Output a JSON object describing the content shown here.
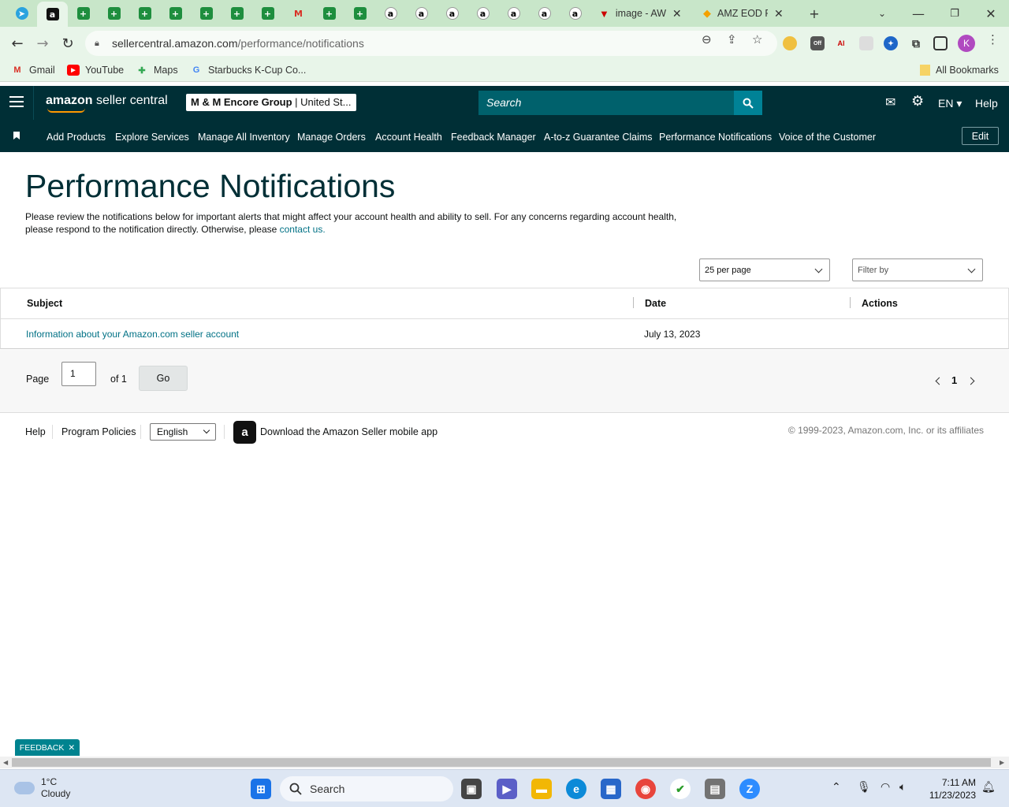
{
  "browser": {
    "tabs": [
      {
        "icon": "telegram-icon"
      },
      {
        "icon": "amazon-icon",
        "active": true
      },
      {
        "icon": "sheets-icon"
      },
      {
        "icon": "sheets-icon"
      },
      {
        "icon": "sheets-icon"
      },
      {
        "icon": "sheets-icon"
      },
      {
        "icon": "sheets-icon"
      },
      {
        "icon": "sheets-icon"
      },
      {
        "icon": "sheets-icon"
      },
      {
        "icon": "gmail-icon"
      },
      {
        "icon": "sheets-icon"
      },
      {
        "icon": "sheets-icon"
      },
      {
        "icon": "amazon-icon"
      },
      {
        "icon": "amazon-icon"
      },
      {
        "icon": "amazon-icon"
      },
      {
        "icon": "amazon-icon"
      },
      {
        "icon": "amazon-icon"
      },
      {
        "icon": "amazon-icon"
      },
      {
        "icon": "amazon-icon"
      }
    ],
    "wide_tabs": [
      {
        "title": "image - AW",
        "icon": "aw-icon"
      },
      {
        "title": "AMZ EOD F",
        "icon": "amz-eod-icon"
      }
    ],
    "url_host": "sellercentral.amazon.com",
    "url_path": "/performance/notifications",
    "profile_initial": "K",
    "bookmarks": [
      {
        "label": "Gmail"
      },
      {
        "label": "YouTube"
      },
      {
        "label": "Maps"
      },
      {
        "label": "Starbucks K-Cup Co..."
      }
    ],
    "all_bookmarks": "All Bookmarks"
  },
  "header": {
    "logo_bold": "amazon",
    "logo_rest": " seller central",
    "store_bold": "M & M Encore Group",
    "store_rest": " | United St...",
    "search_placeholder": "Search",
    "lang": "EN",
    "help": "Help"
  },
  "nav": {
    "links": [
      "Add Products",
      "Explore Services",
      "Manage All Inventory",
      "Manage Orders",
      "Account Health",
      "Feedback Manager",
      "A-to-z Guarantee Claims",
      "Performance Notifications",
      "Voice of the Customer"
    ],
    "edit": "Edit"
  },
  "main": {
    "title": "Performance Notifications",
    "intro": "Please review the notifications below for important alerts that might affect your account health and ability to sell. For any concerns regarding account health, please respond to the notification directly. Otherwise, please ",
    "contact_link": "contact us.",
    "per_page": "25 per page",
    "filter": "Filter by",
    "columns": {
      "subject": "Subject",
      "date": "Date",
      "actions": "Actions"
    },
    "rows": [
      {
        "subject": "Information about your Amazon.com seller account",
        "date": "July 13, 2023",
        "actions": ""
      }
    ],
    "pager": {
      "page_label": "Page",
      "page_value": "1",
      "of_label": "of 1",
      "go": "Go",
      "current": "1"
    }
  },
  "footer": {
    "help": "Help",
    "policies": "Program Policies",
    "language": "English",
    "app": "Download the Amazon Seller mobile app",
    "copyright": "© 1999-2023, Amazon.com, Inc. or its affiliates"
  },
  "feedback": "FEEDBACK",
  "taskbar": {
    "temp": "1°C",
    "weather": "Cloudy",
    "search": "Search",
    "time": "7:11 AM",
    "date": "11/23/2023"
  },
  "colors": {
    "header_bg": "#002f36",
    "link": "#007185",
    "tabstrip": "#c8e6c9"
  }
}
